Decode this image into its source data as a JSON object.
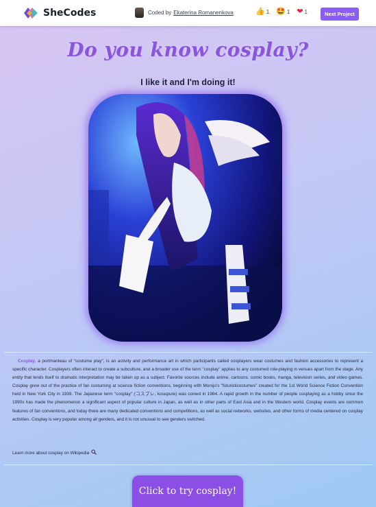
{
  "header": {
    "brand": "SheCodes",
    "coded_by_prefix": "Coded by",
    "author": "Ekaterina Romanenkova",
    "reactions": [
      {
        "icon": "thumbs-up-icon",
        "glyph": "👍",
        "count": "1"
      },
      {
        "icon": "star-struck-icon",
        "glyph": "🤩",
        "count": "1"
      },
      {
        "icon": "heart-icon",
        "glyph": "❤",
        "count": "1"
      }
    ],
    "next_label": "Next Project"
  },
  "main": {
    "title": "Do you know cosplay?",
    "subtitle": "I like it and I'm doing it!",
    "paragraph_lead": "Cosplay",
    "paragraph_body": ", a portmanteau of \"costume play\", is an activity and performance art in which participants called cosplayers wear costumes and fashion accessories to represent a specific character. Cosplayers often interact to create a subculture, and a broader use of the term \"cosplay\" applies to any costumed role-playing in venues apart from the stage. Any entity that lends itself to dramatic interpretation may be taken up as a subject. Favorite sources include anime, cartoons, comic books, manga, television series, and video games. Cosplay grew out of the practice of fan costuming at science fiction conventions, beginning with Morojo's \"futuristicostumes\" created for the 1st World Science Fiction Convention held in New York City in 1939. The Japanese term \"cosplay\" (コスプレ, kosupure) was coined in 1984. A rapid growth in the number of people cosplaying as a hobby since the 1990s has made the phenomenon a significant aspect of popular culture in Japan, as well as in other parts of East Asia and in the Western world. Cosplay events are common features of fan conventions, and today there are many dedicated conventions and competitions, as well as social networks, websites, and other forms of media centered on cosplay activities. Cosplay is very popular among all genders, and it is not unusual to see genders switched.",
    "more_link": "Learn more about cosplay on Wikipedia",
    "cta_label": "Click to try cosplay!"
  },
  "colors": {
    "accent": "#8b5cf6",
    "title": "#8a55de",
    "cta": "#8b4fe6"
  }
}
